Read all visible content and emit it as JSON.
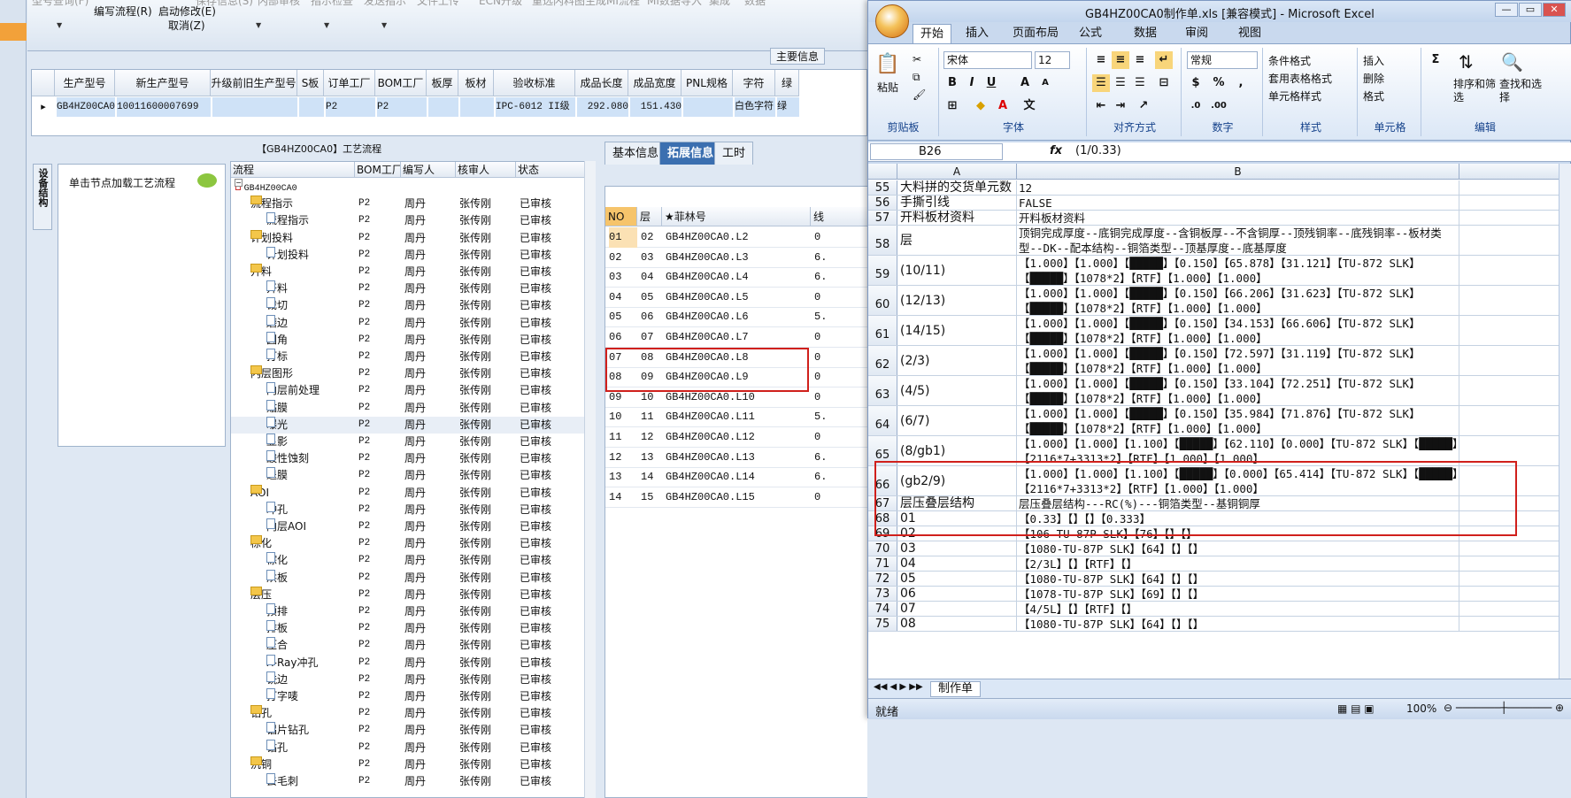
{
  "app": {
    "ribbon_top_faded": [
      "型号查询(F)",
      "保存信息(S)",
      "内部审核",
      "指示检查",
      "发送指示",
      "文件上传",
      "ECN升级",
      "重选内料图",
      "生成MI流程",
      "MI数据导入",
      "集成",
      "数据"
    ],
    "ribbon_buttons": [
      {
        "label": "编写流程(R)"
      },
      {
        "label": "启动修改(E)"
      },
      {
        "label": "取消(Z)"
      }
    ],
    "main_info_label": "主要信息",
    "header_grid": {
      "columns": [
        "生产型号",
        "新生产型号",
        "升级前旧生产型号",
        "S板",
        "订单工厂",
        "BOM工厂",
        "板厚",
        "板材",
        "验收标准",
        "成品长度",
        "成品宽度",
        "PNL规格",
        "字符",
        "绿"
      ],
      "row": [
        "GB4HZ00CA0",
        "10011600007699",
        "",
        "",
        "P2",
        "P2",
        "",
        "",
        "IPC-6012 II级",
        "292.080",
        "151.430",
        "",
        "白色字符",
        "绿"
      ]
    },
    "process_title": "【GB4HZ00CA0】工艺流程",
    "vertical_tab": "设备结构",
    "node_hint": "单击节点加载工艺流程",
    "tree": {
      "columns": [
        "流程",
        "BOM工厂",
        "编写人",
        "核审人",
        "状态"
      ],
      "rows": [
        {
          "level": 0,
          "type": "root",
          "name": "GB4HZ00CA0",
          "bom": "",
          "author": "",
          "reviewer": "",
          "status": ""
        },
        {
          "level": 1,
          "type": "folder",
          "name": "流程指示",
          "bom": "P2",
          "author": "周丹",
          "reviewer": "张传刚",
          "status": "已审核"
        },
        {
          "level": 2,
          "type": "doc",
          "name": "流程指示",
          "bom": "P2",
          "author": "周丹",
          "reviewer": "张传刚",
          "status": "已审核"
        },
        {
          "level": 1,
          "type": "folder",
          "name": "计划投料",
          "bom": "P2",
          "author": "周丹",
          "reviewer": "张传刚",
          "status": "已审核"
        },
        {
          "level": 2,
          "type": "doc",
          "name": "计划投料",
          "bom": "P2",
          "author": "周丹",
          "reviewer": "张传刚",
          "status": "已审核"
        },
        {
          "level": 1,
          "type": "folder",
          "name": "开料",
          "bom": "P2",
          "author": "周丹",
          "reviewer": "张传刚",
          "status": "已审核"
        },
        {
          "level": 2,
          "type": "doc",
          "name": "开料",
          "bom": "P2",
          "author": "周丹",
          "reviewer": "张传刚",
          "status": "已审核"
        },
        {
          "level": 2,
          "type": "doc",
          "name": "裁切",
          "bom": "P2",
          "author": "周丹",
          "reviewer": "张传刚",
          "status": "已审核"
        },
        {
          "level": 2,
          "type": "doc",
          "name": "磨边",
          "bom": "P2",
          "author": "周丹",
          "reviewer": "张传刚",
          "status": "已审核"
        },
        {
          "level": 2,
          "type": "doc",
          "name": "圆角",
          "bom": "P2",
          "author": "周丹",
          "reviewer": "张传刚",
          "status": "已审核"
        },
        {
          "level": 2,
          "type": "doc",
          "name": "打标",
          "bom": "P2",
          "author": "周丹",
          "reviewer": "张传刚",
          "status": "已审核"
        },
        {
          "level": 1,
          "type": "folder",
          "name": "内层图形",
          "bom": "P2",
          "author": "周丹",
          "reviewer": "张传刚",
          "status": "已审核"
        },
        {
          "level": 2,
          "type": "doc",
          "name": "内层前处理",
          "bom": "P2",
          "author": "周丹",
          "reviewer": "张传刚",
          "status": "已审核"
        },
        {
          "level": 2,
          "type": "doc",
          "name": "贴膜",
          "bom": "P2",
          "author": "周丹",
          "reviewer": "张传刚",
          "status": "已审核"
        },
        {
          "level": 2,
          "type": "doc",
          "name": "曝光",
          "bom": "P2",
          "author": "周丹",
          "reviewer": "张传刚",
          "status": "已审核"
        },
        {
          "level": 2,
          "type": "doc",
          "name": "显影",
          "bom": "P2",
          "author": "周丹",
          "reviewer": "张传刚",
          "status": "已审核"
        },
        {
          "level": 2,
          "type": "doc",
          "name": "酸性蚀刻",
          "bom": "P2",
          "author": "周丹",
          "reviewer": "张传刚",
          "status": "已审核"
        },
        {
          "level": 2,
          "type": "doc",
          "name": "退膜",
          "bom": "P2",
          "author": "周丹",
          "reviewer": "张传刚",
          "status": "已审核"
        },
        {
          "level": 1,
          "type": "folder",
          "name": "AOI",
          "bom": "P2",
          "author": "周丹",
          "reviewer": "张传刚",
          "status": "已审核"
        },
        {
          "level": 2,
          "type": "doc",
          "name": "冲孔",
          "bom": "P2",
          "author": "周丹",
          "reviewer": "张传刚",
          "status": "已审核"
        },
        {
          "level": 2,
          "type": "doc",
          "name": "内层AOI",
          "bom": "P2",
          "author": "周丹",
          "reviewer": "张传刚",
          "status": "已审核"
        },
        {
          "level": 1,
          "type": "folder",
          "name": "棕化",
          "bom": "P2",
          "author": "周丹",
          "reviewer": "张传刚",
          "status": "已审核"
        },
        {
          "level": 2,
          "type": "doc",
          "name": "棕化",
          "bom": "P2",
          "author": "周丹",
          "reviewer": "张传刚",
          "status": "已审核"
        },
        {
          "level": 2,
          "type": "doc",
          "name": "烘板",
          "bom": "P2",
          "author": "周丹",
          "reviewer": "张传刚",
          "status": "已审核"
        },
        {
          "level": 1,
          "type": "folder",
          "name": "层压",
          "bom": "P2",
          "author": "周丹",
          "reviewer": "张传刚",
          "status": "已审核"
        },
        {
          "level": 2,
          "type": "doc",
          "name": "预排",
          "bom": "P2",
          "author": "周丹",
          "reviewer": "张传刚",
          "status": "已审核"
        },
        {
          "level": 2,
          "type": "doc",
          "name": "排板",
          "bom": "P2",
          "author": "周丹",
          "reviewer": "张传刚",
          "status": "已审核"
        },
        {
          "level": 2,
          "type": "doc",
          "name": "压合",
          "bom": "P2",
          "author": "周丹",
          "reviewer": "张传刚",
          "status": "已审核"
        },
        {
          "level": 2,
          "type": "doc",
          "name": "X-Ray冲孔",
          "bom": "P2",
          "author": "周丹",
          "reviewer": "张传刚",
          "status": "已审核"
        },
        {
          "level": 2,
          "type": "doc",
          "name": "铣边",
          "bom": "P2",
          "author": "周丹",
          "reviewer": "张传刚",
          "status": "已审核"
        },
        {
          "level": 2,
          "type": "doc",
          "name": "打字唛",
          "bom": "P2",
          "author": "周丹",
          "reviewer": "张传刚",
          "status": "已审核"
        },
        {
          "level": 1,
          "type": "folder",
          "name": "钻孔",
          "bom": "P2",
          "author": "周丹",
          "reviewer": "张传刚",
          "status": "已审核"
        },
        {
          "level": 2,
          "type": "doc",
          "name": "铝片钻孔",
          "bom": "P2",
          "author": "周丹",
          "reviewer": "张传刚",
          "status": "已审核"
        },
        {
          "level": 2,
          "type": "doc",
          "name": "钻孔",
          "bom": "P2",
          "author": "周丹",
          "reviewer": "张传刚",
          "status": "已审核"
        },
        {
          "level": 1,
          "type": "folder",
          "name": "沉铜",
          "bom": "P2",
          "author": "周丹",
          "reviewer": "张传刚",
          "status": "已审核"
        },
        {
          "level": 2,
          "type": "doc",
          "name": "去毛刺",
          "bom": "P2",
          "author": "周丹",
          "reviewer": "张传刚",
          "status": "已审核"
        }
      ]
    },
    "mid_tabs": [
      "基本信息",
      "拓展信息",
      "工时"
    ],
    "mid_grid": {
      "columns": [
        "NO",
        "层",
        "★菲林号",
        "线"
      ],
      "rows": [
        [
          "01",
          "02",
          "GB4HZ00CA0.L2",
          "0"
        ],
        [
          "02",
          "03",
          "GB4HZ00CA0.L3",
          "6."
        ],
        [
          "03",
          "04",
          "GB4HZ00CA0.L4",
          "6."
        ],
        [
          "04",
          "05",
          "GB4HZ00CA0.L5",
          "0"
        ],
        [
          "05",
          "06",
          "GB4HZ00CA0.L6",
          "5."
        ],
        [
          "06",
          "07",
          "GB4HZ00CA0.L7",
          "0"
        ],
        [
          "07",
          "08",
          "GB4HZ00CA0.L8",
          "0"
        ],
        [
          "08",
          "09",
          "GB4HZ00CA0.L9",
          "0"
        ],
        [
          "09",
          "10",
          "GB4HZ00CA0.L10",
          "0"
        ],
        [
          "10",
          "11",
          "GB4HZ00CA0.L11",
          "5."
        ],
        [
          "11",
          "12",
          "GB4HZ00CA0.L12",
          "0"
        ],
        [
          "12",
          "13",
          "GB4HZ00CA0.L13",
          "6."
        ],
        [
          "13",
          "14",
          "GB4HZ00CA0.L14",
          "6."
        ],
        [
          "14",
          "15",
          "GB4HZ00CA0.L15",
          "0"
        ]
      ]
    }
  },
  "excel": {
    "title": "GB4HZ00CA0制作单.xls  [兼容模式] - Microsoft Excel",
    "menu": [
      "开始",
      "插入",
      "页面布局",
      "公式",
      "数据",
      "审阅",
      "视图"
    ],
    "ribbon": {
      "paste": "粘贴",
      "clipboard_group": "剪贴板",
      "font_name": "宋体",
      "font_size": "12",
      "font_group": "字体",
      "align_group": "对齐方式",
      "number_format": "常规",
      "number_group": "数字",
      "cond_format": "条件格式",
      "table_format": "套用表格格式",
      "cell_style": "单元格样式",
      "style_group": "样式",
      "insert": "插入",
      "delete": "删除",
      "format": "格式",
      "cells_group": "单元格",
      "sort_filter": "排序和筛选",
      "find_select": "查找和选择",
      "edit_group": "编辑"
    },
    "name_box": "B26",
    "formula_value": "(1/0.33)",
    "columns": [
      "A",
      "B"
    ],
    "rows": [
      {
        "n": "55",
        "a": "大料拼的交货单元数",
        "b": "12",
        "h": 17
      },
      {
        "n": "56",
        "a": "手撕引线",
        "b": "FALSE",
        "h": 17
      },
      {
        "n": "57",
        "a": "开料板材资料",
        "b": "开料板材资料",
        "h": 17
      },
      {
        "n": "58",
        "a": "层",
        "b": "顶铜完成厚度--底铜完成厚度--含铜板厚--不含铜厚--顶残铜率--底残铜率--板材类型--DK--配本结构--铜箔类型--顶基厚度--底基厚度",
        "h": 34
      },
      {
        "n": "59",
        "a": "(10/11)",
        "b": "【1.000】【1.000】【█████】【0.150】【65.878】【31.121】【TU-872 SLK】【█████】【1078*2】【RTF】【1.000】【1.000】",
        "h": 34
      },
      {
        "n": "60",
        "a": "(12/13)",
        "b": "【1.000】【1.000】【█████】【0.150】【66.206】【31.623】【TU-872 SLK】【█████】【1078*2】【RTF】【1.000】【1.000】",
        "h": 34
      },
      {
        "n": "61",
        "a": "(14/15)",
        "b": "【1.000】【1.000】【█████】【0.150】【34.153】【66.606】【TU-872 SLK】【█████】【1078*2】【RTF】【1.000】【1.000】",
        "h": 34
      },
      {
        "n": "62",
        "a": "(2/3)",
        "b": "【1.000】【1.000】【█████】【0.150】【72.597】【31.119】【TU-872 SLK】【█████】【1078*2】【RTF】【1.000】【1.000】",
        "h": 34
      },
      {
        "n": "63",
        "a": "(4/5)",
        "b": "【1.000】【1.000】【█████】【0.150】【33.104】【72.251】【TU-872 SLK】【█████】【1078*2】【RTF】【1.000】【1.000】",
        "h": 34
      },
      {
        "n": "64",
        "a": "(6/7)",
        "b": "【1.000】【1.000】【█████】【0.150】【35.984】【71.876】【TU-872 SLK】【█████】【1078*2】【RTF】【1.000】【1.000】",
        "h": 34
      },
      {
        "n": "65",
        "a": "(8/gb1)",
        "b": "【1.000】【1.000】【1.100】【█████】【62.110】【0.000】【TU-872 SLK】【█████】【2116*7+3313*2】【RTF】【1.000】【1.000】",
        "h": 34
      },
      {
        "n": "66",
        "a": "(gb2/9)",
        "b": "【1.000】【1.000】【1.100】【█████】【0.000】【65.414】【TU-872 SLK】【█████】【2116*7+3313*2】【RTF】【1.000】【1.000】",
        "h": 34
      },
      {
        "n": "67",
        "a": "层压叠层结构",
        "b": "层压叠层结构---RC(%)---铜箔类型--基铜铜厚",
        "h": 17
      },
      {
        "n": "68",
        "a": "01",
        "b": "【0.33】【】【】【0.333】",
        "h": 17
      },
      {
        "n": "69",
        "a": "02",
        "b": "【106-TU-87P SLK】【76】【】【】",
        "h": 17
      },
      {
        "n": "70",
        "a": "03",
        "b": "【1080-TU-87P SLK】【64】【】【】",
        "h": 17
      },
      {
        "n": "71",
        "a": "04",
        "b": "【2/3L】【】【RTF】【】",
        "h": 17
      },
      {
        "n": "72",
        "a": "05",
        "b": "【1080-TU-87P SLK】【64】【】【】",
        "h": 17
      },
      {
        "n": "73",
        "a": "06",
        "b": "【1078-TU-87P SLK】【69】【】【】",
        "h": 17
      },
      {
        "n": "74",
        "a": "07",
        "b": "【4/5L】【】【RTF】【】",
        "h": 17
      },
      {
        "n": "75",
        "a": "08",
        "b": "【1080-TU-87P SLK】【64】【】【】",
        "h": 17
      }
    ],
    "sheet_tab": "制作单",
    "status": "就绪",
    "zoom": "100%"
  }
}
